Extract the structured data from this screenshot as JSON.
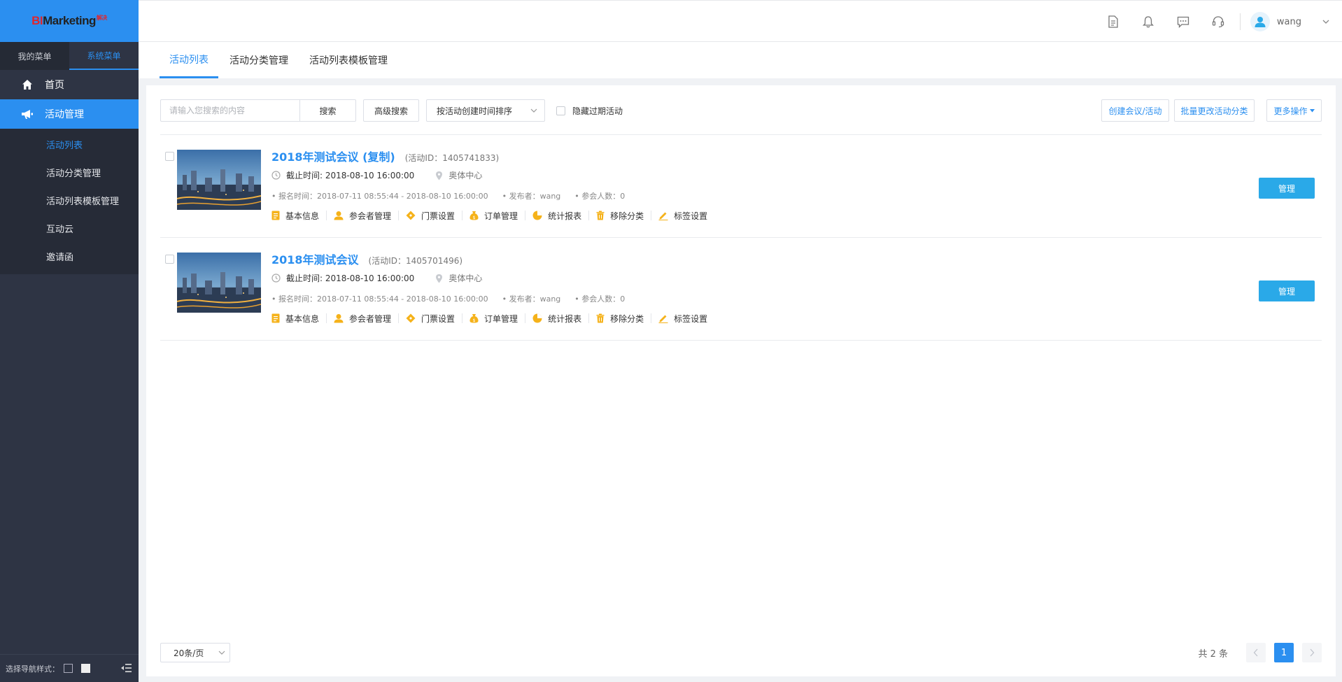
{
  "app": {
    "logo": {
      "bi": "BI",
      "rest": "Marketing",
      "sup": "解决"
    }
  },
  "sidebar": {
    "tabs": [
      {
        "label": "我的菜单"
      },
      {
        "label": "系统菜单"
      }
    ],
    "nav": {
      "home": "首页",
      "activity": "活动管理"
    },
    "sub_items": [
      {
        "label": "活动列表"
      },
      {
        "label": "活动分类管理"
      },
      {
        "label": "活动列表模板管理"
      },
      {
        "label": "互动云"
      },
      {
        "label": "邀请函"
      }
    ],
    "footer_label": "选择导航样式："
  },
  "header": {
    "user_name": "wang"
  },
  "main_tabs": [
    {
      "label": "活动列表"
    },
    {
      "label": "活动分类管理"
    },
    {
      "label": "活动列表模板管理"
    }
  ],
  "toolbar": {
    "search_placeholder": "请输入您搜索的内容",
    "search_btn": "搜索",
    "advanced_btn": "高级搜索",
    "sort_value": "按活动创建时间排序",
    "hide_expired": "隐藏过期活动",
    "create_btn": "创建会议/活动",
    "batch_btn": "批量更改活动分类",
    "more_btn": "更多操作"
  },
  "events": [
    {
      "title": "2018年测试会议 (复制)",
      "id_text": "(活动ID：1405741833)",
      "deadline": "截止时间: 2018-08-10 16:00:00",
      "location": "奥体中心",
      "signup": "• 报名时间：2018-07-11 08:55:44 - 2018-08-10 16:00:00",
      "publisher": "• 发布者：wang",
      "attendees": "• 参会人数：0",
      "manage": "管理"
    },
    {
      "title": "2018年测试会议",
      "id_text": "(活动ID：1405701496)",
      "deadline": "截止时间: 2018-08-10 16:00:00",
      "location": "奥体中心",
      "signup": "• 报名时间：2018-07-11 08:55:44 - 2018-08-10 16:00:00",
      "publisher": "• 发布者：wang",
      "attendees": "• 参会人数：0",
      "manage": "管理"
    }
  ],
  "actions": [
    {
      "label": "基本信息",
      "icon": "document-icon"
    },
    {
      "label": "参会者管理",
      "icon": "person-icon"
    },
    {
      "label": "门票设置",
      "icon": "ticket-icon"
    },
    {
      "label": "订单管理",
      "icon": "money-bag-icon"
    },
    {
      "label": "统计报表",
      "icon": "pie-chart-icon"
    },
    {
      "label": "移除分类",
      "icon": "trash-icon"
    },
    {
      "label": "标签设置",
      "icon": "pencil-icon"
    }
  ],
  "pagination": {
    "page_size": "20条/页",
    "total": "共 2 条",
    "current": "1"
  },
  "colors": {
    "primary": "#2b8ff0",
    "sidebar": "#2e3444",
    "manage_btn": "#2aa9e8",
    "action_icon": "#f5b21a"
  }
}
